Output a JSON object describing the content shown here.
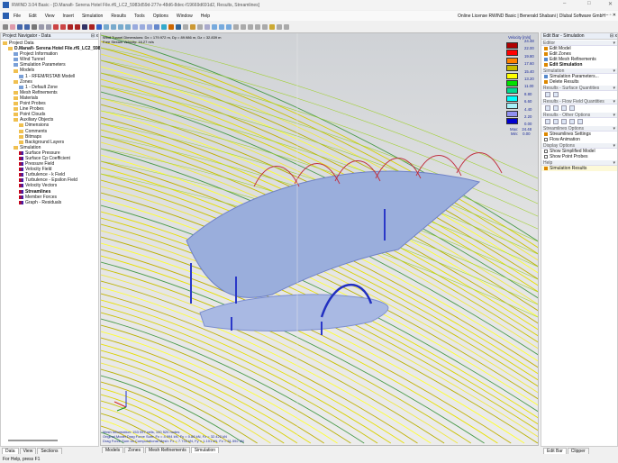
{
  "window": {
    "title": "RWIND 3.04 Basic - [D.Manafi- Serena Hotel File.rf6_LC2_5983d59d-277e-48d6-8dec-f19669d691d2, Results, Streamlines]",
    "controls": [
      "–",
      "□",
      "✕"
    ],
    "license": "Online License RWIND Basic | Benerald Shabani | Dlubal Software GmbH",
    "mdi_controls": "– ▫ ✕"
  },
  "menu": [
    "File",
    "Edit",
    "View",
    "Insert",
    "Simulation",
    "Results",
    "Tools",
    "Options",
    "Window",
    "Help"
  ],
  "navigator": {
    "title": "Project Navigator - Data",
    "pin": "⊟ x",
    "items": [
      {
        "label": "Project Data",
        "level": 0,
        "icon": "folder"
      },
      {
        "label": "D.Manafi- Serena Hotel File.rf6_LC2_5983",
        "level": 1,
        "icon": "folder",
        "bold": true
      },
      {
        "label": "Project Information",
        "level": 2,
        "icon": "doc"
      },
      {
        "label": "Wind Tunnel",
        "level": 2,
        "icon": "doc"
      },
      {
        "label": "Simulation Parameters",
        "level": 2,
        "icon": "doc"
      },
      {
        "label": "Models",
        "level": 2,
        "icon": "folder"
      },
      {
        "label": "1 - RFEM/RSTAB Modell",
        "level": 3,
        "icon": "doc"
      },
      {
        "label": "Zones",
        "level": 2,
        "icon": "folder"
      },
      {
        "label": "1 - Default Zone",
        "level": 3,
        "icon": "doc"
      },
      {
        "label": "Mesh Refinements",
        "level": 2,
        "icon": "folder"
      },
      {
        "label": "Materials",
        "level": 2,
        "icon": "folder"
      },
      {
        "label": "Point Probes",
        "level": 2,
        "icon": "folder"
      },
      {
        "label": "Line Probes",
        "level": 2,
        "icon": "folder"
      },
      {
        "label": "Point Clouds",
        "level": 2,
        "icon": "folder"
      },
      {
        "label": "Auxiliary Objects",
        "level": 2,
        "icon": "folder"
      },
      {
        "label": "Dimensions",
        "level": 3,
        "icon": "folder"
      },
      {
        "label": "Comments",
        "level": 3,
        "icon": "folder"
      },
      {
        "label": "Bitmaps",
        "level": 3,
        "icon": "folder"
      },
      {
        "label": "Background Layers",
        "level": 3,
        "icon": "folder"
      },
      {
        "label": "Simulation",
        "level": 2,
        "icon": "folder"
      },
      {
        "label": "Surface Pressure",
        "level": 3,
        "icon": "res"
      },
      {
        "label": "Surface Cp Coefficient",
        "level": 3,
        "icon": "res"
      },
      {
        "label": "Pressure Field",
        "level": 3,
        "icon": "res"
      },
      {
        "label": "Velocity Field",
        "level": 3,
        "icon": "res"
      },
      {
        "label": "Turbulence - k Field",
        "level": 3,
        "icon": "res"
      },
      {
        "label": "Turbulence - Epsilon Field",
        "level": 3,
        "icon": "res"
      },
      {
        "label": "Velocity Vectors",
        "level": 3,
        "icon": "res"
      },
      {
        "label": "Streamlines",
        "level": 3,
        "icon": "res",
        "bold": true
      },
      {
        "label": "Member Forces",
        "level": 3,
        "icon": "res"
      },
      {
        "label": "Graph - Residuals",
        "level": 3,
        "icon": "res"
      }
    ],
    "tabs": [
      "Data",
      "View",
      "Sections"
    ]
  },
  "viewport": {
    "info": [
      "Wind Tunnel Dimensions: Dx = 179.972 m, Dy = 89.986 m, Dz = 32.839 m",
      "Free Stream Velocity: 16.27 m/s"
    ],
    "mesh_info": [
      "Mesh Information: 153 097 cells, 100 520 nodes",
      "Original Model Drag Force Sum: Fx = 4.994 kN, Fy = 0.88 kN, Fz = 32.422 kN",
      "Drag Force Sum on Computational Mesh: Fx = 7.733 kN, Fy = 1.101 kN, Fz = 31.592 kN"
    ],
    "tabs": [
      "Models",
      "Zones",
      "Mesh Refinements",
      "Simulation"
    ],
    "active_tab": "Simulation"
  },
  "legend": {
    "title": "Velocity [m/s]",
    "values": [
      "24.48",
      "22.00",
      "19.80",
      "17.60",
      "15.40",
      "13.20",
      "11.00",
      "8.80",
      "6.60",
      "4.40",
      "2.20",
      "0.00"
    ],
    "colors": [
      "#b00000",
      "#ff0000",
      "#ff8000",
      "#c8bc00",
      "#ffff00",
      "#00e000",
      "#00d890",
      "#00ffff",
      "#a8f0f8",
      "#9090f0",
      "#0000d0"
    ],
    "max_label": "Max:",
    "max": "24.48",
    "min_label": "Min:",
    "min": "0.00"
  },
  "editbar": {
    "title": "Edit Bar - Simulation",
    "sections": [
      {
        "title": "Editor",
        "items": [
          "Edit Model",
          "Edit Zones",
          "Edit Mesh Refinements",
          "Edit Simulation"
        ]
      },
      {
        "title": "Simulation",
        "items": [
          "Simulation Parameters...",
          "Delete Results"
        ]
      },
      {
        "title": "Results - Surface Quantities",
        "buttons": 2
      },
      {
        "title": "Results - Flow Field Quantities",
        "buttons": 4
      },
      {
        "title": "Results - Other Options",
        "buttons": 5
      },
      {
        "title": "Streamlines Options",
        "items": [
          "Streamlines Settings"
        ],
        "checks": [
          "Flow Animation"
        ]
      },
      {
        "title": "Display Options",
        "checks": [
          "Show Simplified Model",
          "Show Point Probes"
        ]
      },
      {
        "title": "Help",
        "items": [
          "Simulation Results"
        ]
      }
    ],
    "tabs": [
      "Edit Bar",
      "Clipper"
    ]
  },
  "status": "For Help, press F1"
}
